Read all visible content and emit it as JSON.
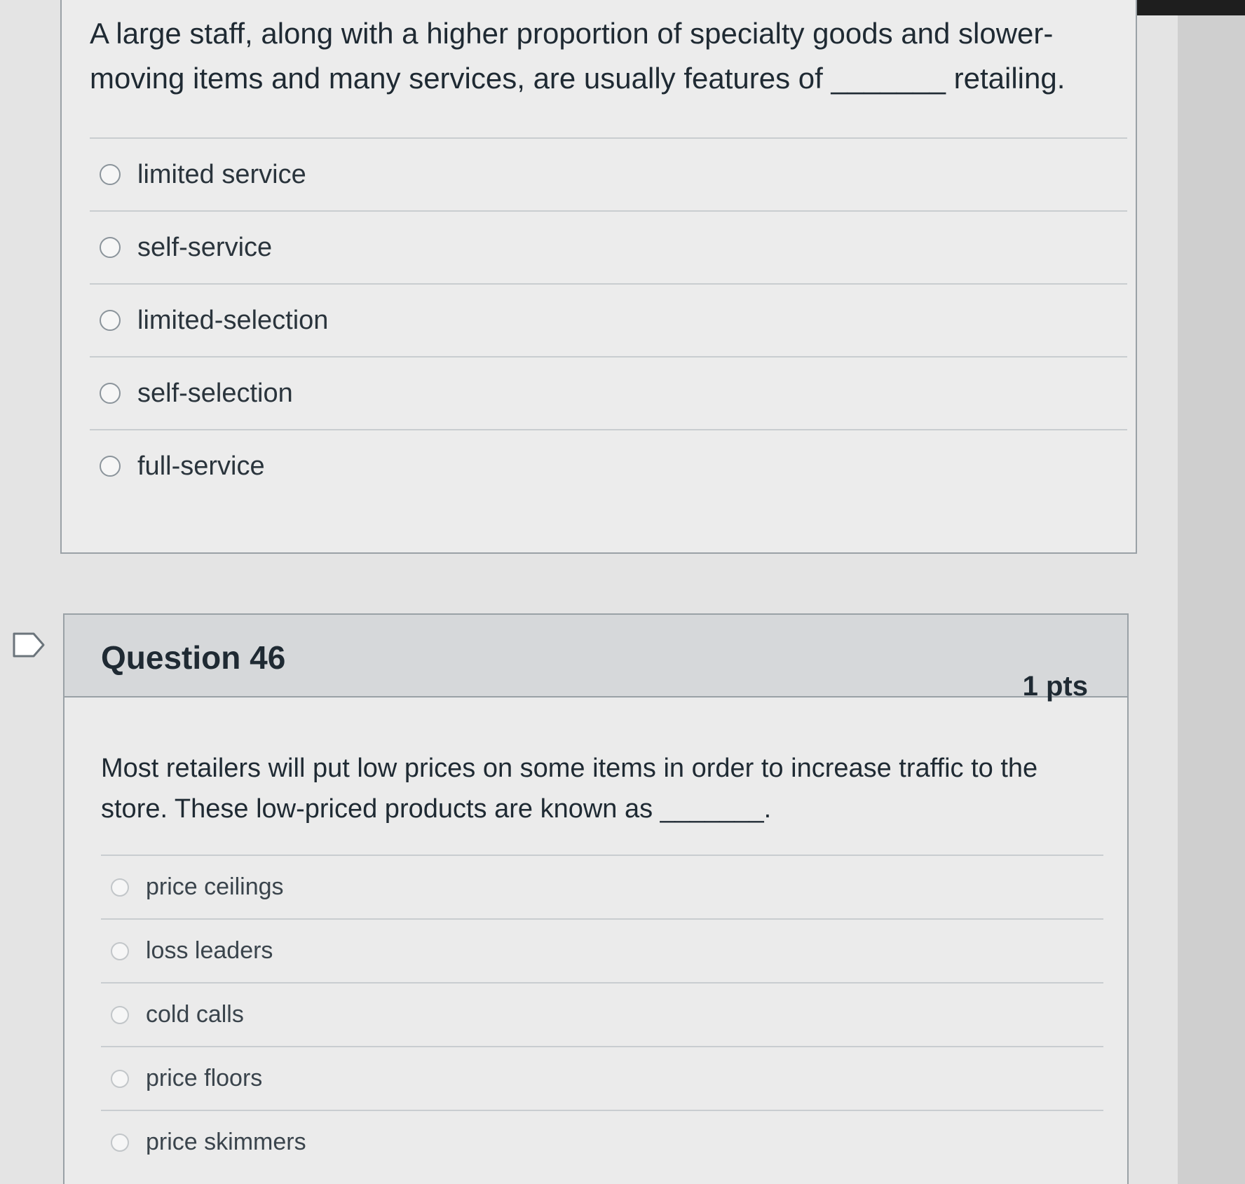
{
  "question_prev": {
    "text": "A large staff, along with a higher proportion of specialty goods and slower-moving items and many services, are usually features of _______ retailing.",
    "answers": [
      {
        "label": "limited service"
      },
      {
        "label": "self-service"
      },
      {
        "label": "limited-selection"
      },
      {
        "label": "self-selection"
      },
      {
        "label": "full-service"
      }
    ]
  },
  "question_current": {
    "title": "Question 46",
    "points": "1 pts",
    "text": "Most retailers will put low prices on some items in order to increase traffic to the store. These low-priced products are known as _______.",
    "answers": [
      {
        "label": "price ceilings"
      },
      {
        "label": "loss leaders"
      },
      {
        "label": "cold calls"
      },
      {
        "label": "price floors"
      },
      {
        "label": "price skimmers"
      }
    ]
  },
  "icons": {
    "flag": "flag-question-icon",
    "radio": "radio-unselected-icon"
  }
}
